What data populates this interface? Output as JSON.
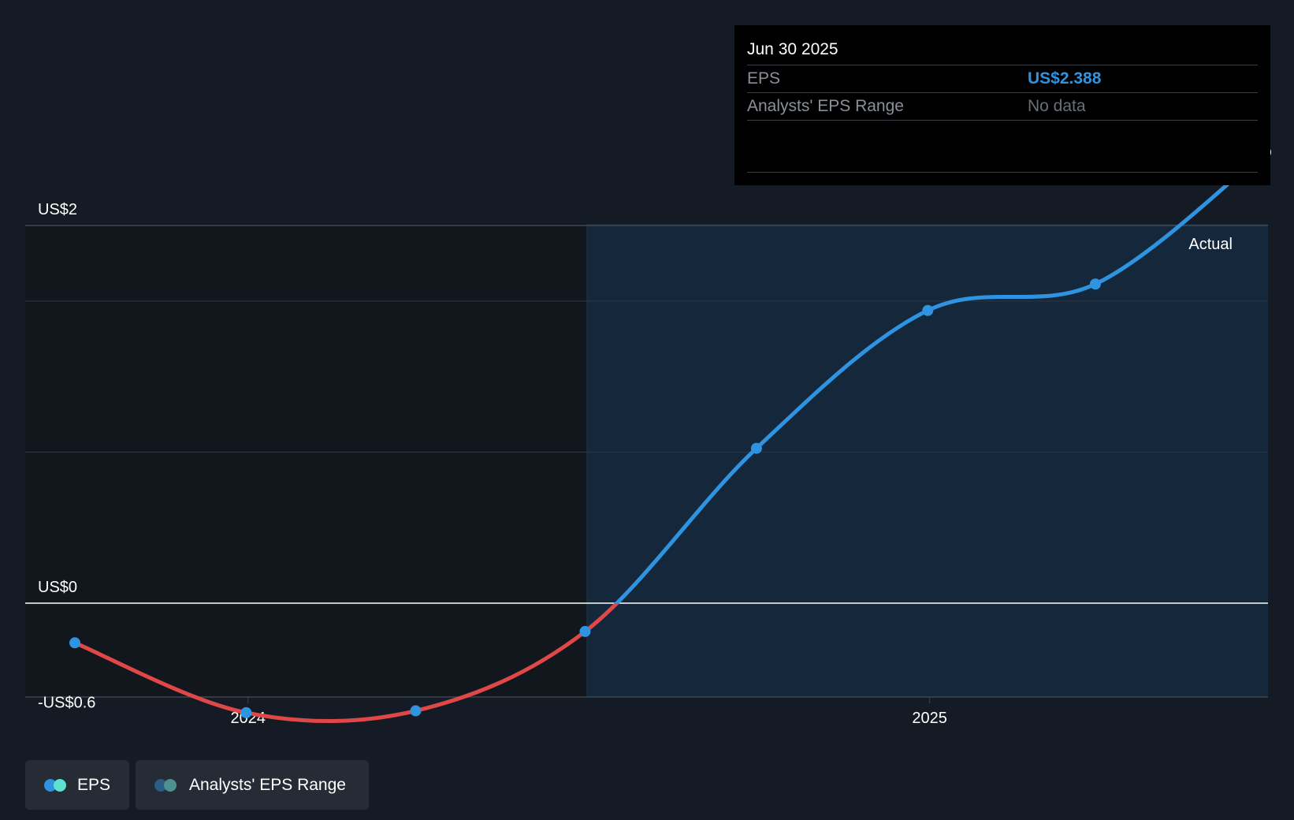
{
  "tooltip": {
    "date": "Jun 30 2025",
    "eps_label": "EPS",
    "eps_value": "US$2.388",
    "range_label": "Analysts' EPS Range",
    "range_value": "No data"
  },
  "chart_data": {
    "type": "line",
    "y_tick_labels": [
      "US$2",
      "US$0",
      "-US$0.6"
    ],
    "x_tick_labels": [
      "2024",
      "2025"
    ],
    "ylim": [
      -0.6,
      2.4
    ],
    "grid": true,
    "annotation": "Actual",
    "series": [
      {
        "name": "EPS",
        "x": [
          "2023-09-30",
          "2023-12-31",
          "2024-03-31",
          "2024-06-30",
          "2024-09-30",
          "2024-12-31",
          "2025-03-31",
          "2025-06-30"
        ],
        "values": [
          -0.21,
          -0.58,
          -0.57,
          -0.15,
          0.82,
          1.55,
          1.69,
          2.388
        ]
      }
    ],
    "colors": {
      "positive": "#2e93e0",
      "negative": "#e04848",
      "forecast_bg": "#1a2c3f"
    }
  },
  "legend": [
    {
      "label": "EPS",
      "color_a": "#2e93e0",
      "color_b": "#5ee0d0"
    },
    {
      "label": "Analysts' EPS Range",
      "color_a": "#2b5d86",
      "color_b": "#4f9090"
    }
  ]
}
